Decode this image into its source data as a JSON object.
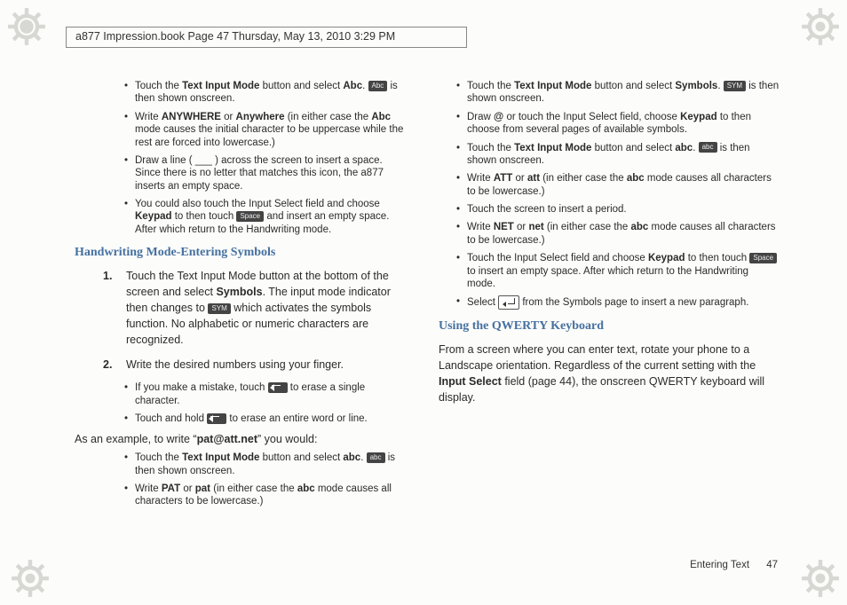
{
  "header": {
    "text": "a877 Impression.book  Page 47  Thursday, May 13, 2010  3:29 PM"
  },
  "left": {
    "b1a": "Touch the ",
    "b1b": "Text Input Mode",
    "b1c": " button and select ",
    "b1d": "Abc",
    "b1e": ". ",
    "b1key": "Abc",
    "b1f": " is then shown onscreen.",
    "b2a": "Write ",
    "b2b": "ANYWHERE",
    "b2c": " or ",
    "b2d": "Anywhere",
    "b2e": " (in either case the ",
    "b2f": "Abc",
    "b2g": " mode causes the initial character to be uppercase while the rest are forced into lowercase.)",
    "b3": "Draw a line ( ___ ) across the screen to insert a space. Since there is no letter that matches this icon, the a877 inserts an empty space.",
    "b4a": "You could also touch the Input Select field and choose ",
    "b4b": "Keypad",
    "b4c": " to then touch ",
    "b4key": "Space",
    "b4d": " and insert an empty space. After which return to the Handwriting mode.",
    "h1": "Handwriting Mode-Entering Symbols",
    "s1a": "Touch the Text Input Mode button at the bottom of the screen and select ",
    "s1b": "Symbols",
    "s1c": ". The input mode indicator then changes to ",
    "s1key": "SYM",
    "s1d": " which activates the symbols function. No alphabetic or numeric characters are recognized.",
    "s2": "Write the desired numbers using your finger.",
    "s2b1a": "If you make a mistake, touch ",
    "s2b1b": " to erase a single character.",
    "s2b2a": "Touch and hold ",
    "s2b2b": " to erase an entire word or line.",
    "exA": "As an example, to write “",
    "exB": "pat@att.net",
    "exC": "” you would:",
    "exb1a": "Touch the ",
    "exb1b": "Text Input Mode",
    "exb1c": " button and select ",
    "exb1d": "abc",
    "exb1e": ". ",
    "exb1key": "abc",
    "exb1f": " is then shown onscreen.",
    "exb2a": "Write ",
    "exb2b": "PAT",
    "exb2c": " or ",
    "exb2d": "pat",
    "exb2e": " (in either case the ",
    "exb2f": "abc",
    "exb2g": " mode causes all characters to be lowercase.)"
  },
  "right": {
    "b1a": "Touch the ",
    "b1b": "Text Input Mode",
    "b1c": " button and select ",
    "b1d": "Symbols",
    "b1e": ". ",
    "b1key": "SYM",
    "b1f": " is then shown onscreen.",
    "b2a": "Draw ",
    "b2b": "@",
    "b2c": " or touch the Input Select field, choose ",
    "b2d": "Keypad",
    "b2e": " to then choose from several pages of available symbols.",
    "b3a": "Touch the ",
    "b3b": "Text Input Mode",
    "b3c": " button and select ",
    "b3d": "abc",
    "b3e": ". ",
    "b3key": "abc",
    "b3f": " is then shown onscreen.",
    "b4a": "Write ",
    "b4b": "ATT",
    "b4c": " or ",
    "b4d": "att",
    "b4e": " (in either case the ",
    "b4f": "abc",
    "b4g": " mode causes all characters to be lowercase.)",
    "b5": "Touch the screen to insert a period.",
    "b6a": "Write ",
    "b6b": "NET",
    "b6c": " or ",
    "b6d": "net",
    "b6e": " (in either case the ",
    "b6f": "abc",
    "b6g": " mode causes all characters to be lowercase.)",
    "b7a": "Touch the Input Select field and choose ",
    "b7b": "Keypad",
    "b7c": " to then touch ",
    "b7key": "Space",
    "b7d": " to insert an empty space. After which return to the Handwriting mode.",
    "b8a": "Select ",
    "b8b": " from the Symbols page to insert a new paragraph.",
    "h1": "Using the QWERTY Keyboard",
    "pA": "From a screen where you can enter text, rotate your phone to a Landscape orientation. Regardless of the current setting with the ",
    "pB": "Input Select",
    "pC": " field (page 44), the onscreen QWERTY keyboard will display."
  },
  "footer": {
    "section": "Entering Text",
    "page": "47"
  }
}
